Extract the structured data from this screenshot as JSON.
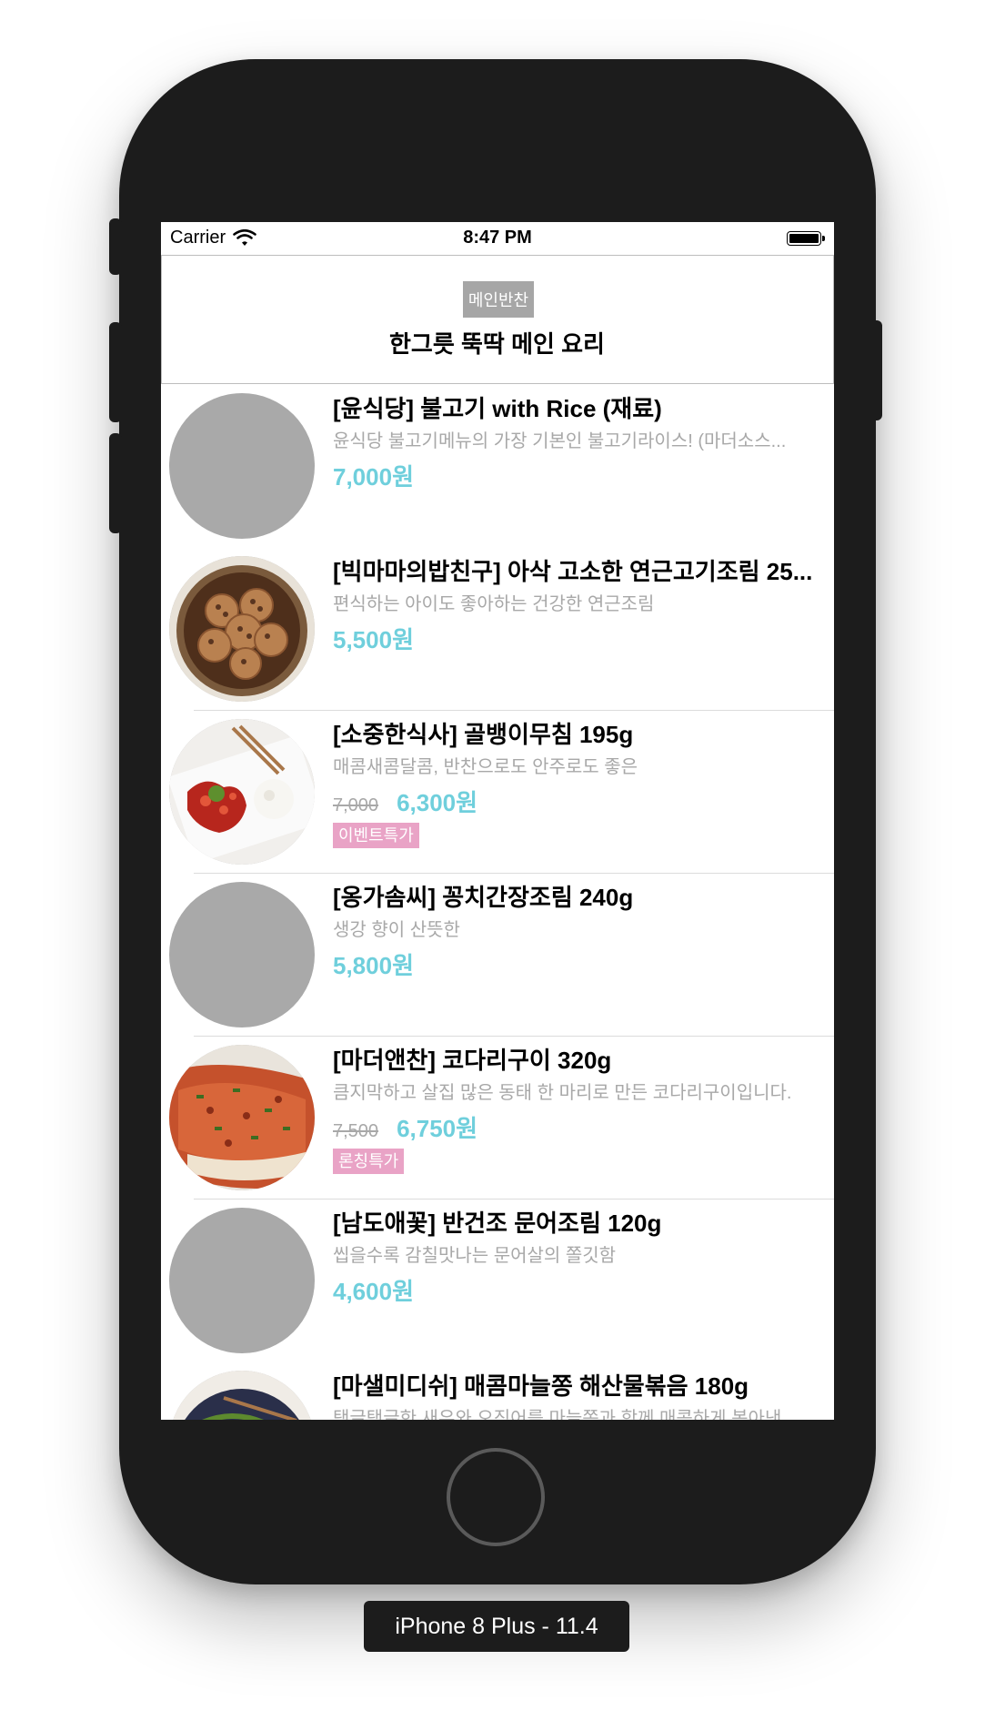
{
  "status_bar": {
    "carrier": "Carrier",
    "time": "8:47 PM"
  },
  "header": {
    "badge": "메인반찬",
    "title": "한그릇 뚝딱 메인 요리"
  },
  "items": [
    {
      "name": "[윤식당] 불고기 with Rice (재료)",
      "desc": "윤식당 불고기메뉴의 가장 기본인 불고기라이스! (마더소스...",
      "old_price": "",
      "price": "7,000원",
      "tag": "",
      "image": "placeholder"
    },
    {
      "name": "[빅마마의밥친구] 아삭 고소한 연근고기조림 25...",
      "desc": "편식하는 아이도 좋아하는 건강한 연근조림",
      "old_price": "",
      "price": "5,500원",
      "tag": "",
      "image": "lotus-root-braised"
    },
    {
      "name": "[소중한식사] 골뱅이무침 195g",
      "desc": "매콤새콤달콤, 반찬으로도 안주로도 좋은",
      "old_price": "7,000",
      "price": "6,300원",
      "tag": "이벤트특가",
      "image": "spicy-whelk-salad"
    },
    {
      "name": "[옹가솜씨] 꽁치간장조림 240g",
      "desc": "생강 향이 산뜻한",
      "old_price": "",
      "price": "5,800원",
      "tag": "",
      "image": "placeholder"
    },
    {
      "name": "[마더앤찬] 코다리구이 320g",
      "desc": "큼지막하고 살집 많은 동태 한 마리로 만든 코다리구이입니다.",
      "old_price": "7,500",
      "price": "6,750원",
      "tag": "론칭특가",
      "image": "grilled-pollock"
    },
    {
      "name": "[남도애꽃] 반건조 문어조림 120g",
      "desc": "씹을수록 감칠맛나는 문어살의 쫄깃함",
      "old_price": "",
      "price": "4,600원",
      "tag": "",
      "image": "placeholder"
    },
    {
      "name": "[마샐미디쉬] 매콤마늘쫑 해산물볶음 180g",
      "desc": "탱글탱글한 새우와 오징어를 마늘쫑과 함께 매콤하게 볶아낸...",
      "old_price": "",
      "price": "",
      "tag": "",
      "image": "stir-fried-seafood"
    }
  ],
  "device_label": "iPhone 8 Plus - 11.4",
  "colors": {
    "price": "#6fcfdc",
    "tag": "#e9a3c6",
    "badge": "#a6a6a6",
    "placeholder": "#a9a9a9",
    "bezel": "#1c1c1c"
  }
}
